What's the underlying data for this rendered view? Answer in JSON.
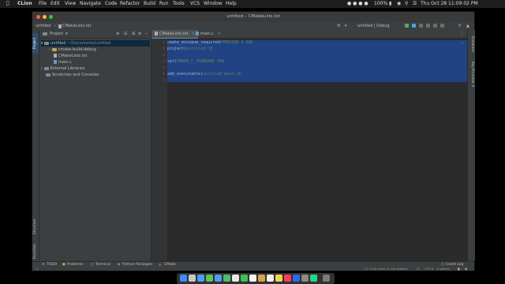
{
  "menubar": {
    "app": "CLion",
    "items": [
      "File",
      "Edit",
      "View",
      "Navigate",
      "Code",
      "Refactor",
      "Build",
      "Run",
      "Tools",
      "VCS",
      "Window",
      "Help"
    ],
    "battery": "100%",
    "datetime": "Thu Oct 28  11:09:02 PM"
  },
  "window": {
    "title": "untitled – CMakeLists.txt"
  },
  "navbar": {
    "project": "untitled",
    "file": "CMakeLists.txt",
    "run_config": "untitled | Debug"
  },
  "sidebar_left": {
    "tabs": [
      "Project",
      "Structure",
      "Favorites"
    ]
  },
  "project_panel": {
    "title": "Project",
    "tree": [
      {
        "label": "untitled",
        "extra": "~/Documents/untitled",
        "kind": "folder",
        "level": 0
      },
      {
        "label": "cmake-build-debug",
        "kind": "folder",
        "level": 1
      },
      {
        "label": "CMakeLists.txt",
        "kind": "file",
        "level": 1
      },
      {
        "label": "main.c",
        "kind": "file",
        "level": 1
      },
      {
        "label": "External Libraries",
        "kind": "folder",
        "level": 0
      },
      {
        "label": "Scratches and Consoles",
        "kind": "folder",
        "level": 0
      }
    ]
  },
  "editor": {
    "tabs": [
      {
        "label": "CMakeLists.txt",
        "active": true
      },
      {
        "label": "main.c",
        "active": false
      }
    ],
    "line_numbers": [
      "1",
      "2",
      "3",
      "4",
      "5",
      "6",
      "7"
    ],
    "lines": [
      {
        "cmd": "cmake_minimum_required",
        "args": "VERSION 3.20"
      },
      {
        "cmd": "project",
        "args": "untitled C"
      },
      {
        "cmd": "",
        "args": ""
      },
      {
        "cmd": "set",
        "args": "CMAKE_C_STANDARD 99"
      },
      {
        "cmd": "",
        "args": ""
      },
      {
        "cmd": "add_executable",
        "args": "untitled main.c"
      },
      {
        "cmd": "",
        "args": ""
      }
    ]
  },
  "sidebar_right": {
    "tabs": [
      "Database",
      "Key Promoter X"
    ]
  },
  "tool_windows": [
    "TODO",
    "Problems",
    "Terminal",
    "Python Packages",
    "CMake"
  ],
  "event_log": "Event Log",
  "statusbar": {
    "caret": "1:1 (118 chars, 6 line breaks)",
    "line_sep": "LF",
    "encoding": "UTF-8",
    "indent": "4 spaces"
  },
  "colors": {
    "selection": "#214283",
    "editor_bg": "#2b2b2b",
    "panel_bg": "#3c3f41"
  }
}
